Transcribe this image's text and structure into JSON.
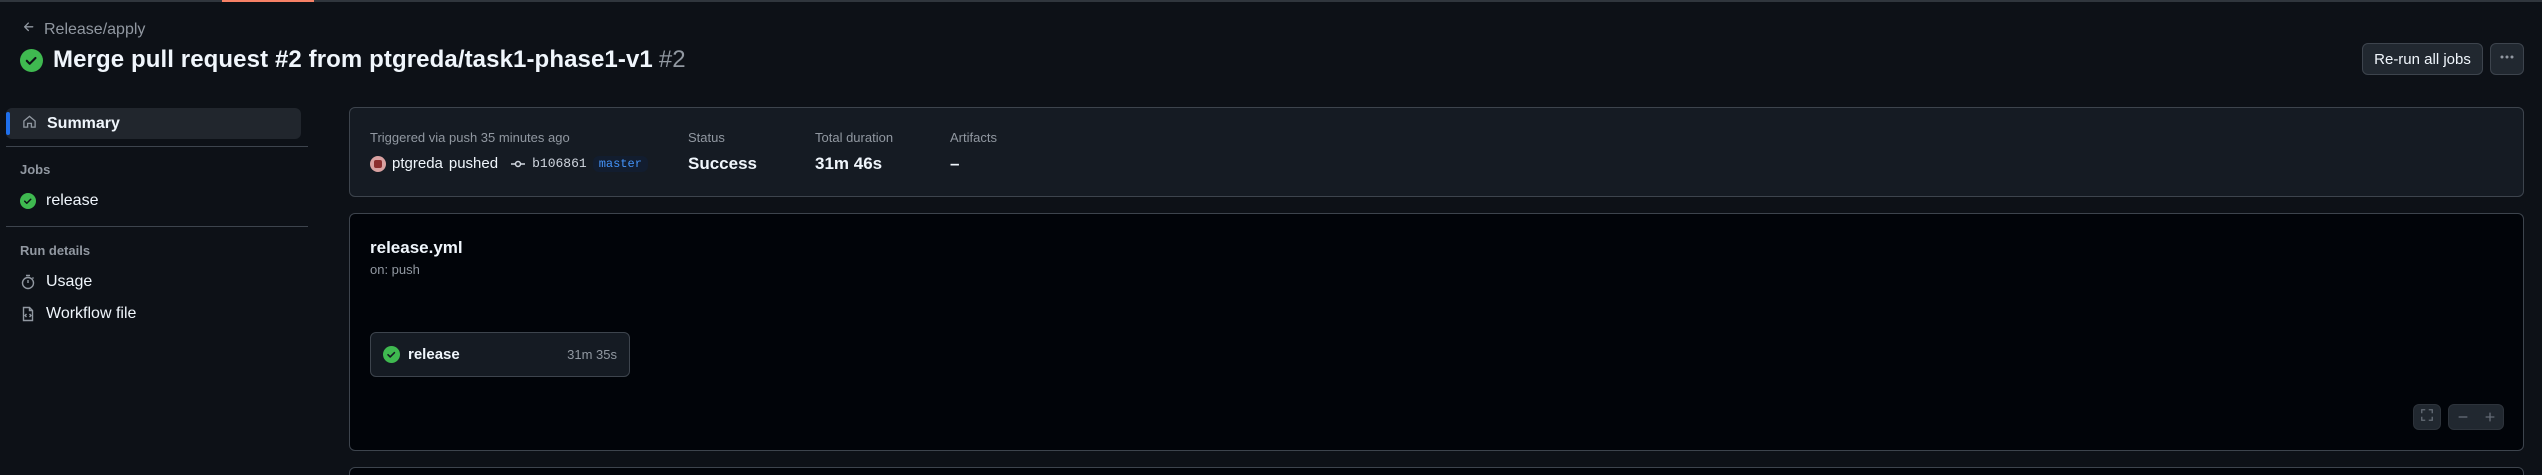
{
  "breadcrumb": {
    "back_label": "Release/apply"
  },
  "header": {
    "title": "Merge pull request #2 from ptgreda/task1-phase1-v1",
    "run_number": "#2",
    "rerun_label": "Re-run all jobs",
    "status": "success"
  },
  "sidebar": {
    "summary_label": "Summary",
    "jobs_heading": "Jobs",
    "jobs": [
      {
        "label": "release",
        "status": "success"
      }
    ],
    "run_details_heading": "Run details",
    "usage_label": "Usage",
    "workflow_file_label": "Workflow file"
  },
  "summary": {
    "trigger_label": "Triggered via push 35 minutes ago",
    "actor": "ptgreda",
    "action": "pushed",
    "commit_sha": "b106861",
    "branch": "master",
    "status_label": "Status",
    "status_value": "Success",
    "duration_label": "Total duration",
    "duration_value": "31m 46s",
    "artifacts_label": "Artifacts",
    "artifacts_value": "–"
  },
  "workflow": {
    "file_name": "release.yml",
    "trigger": "on: push",
    "job": {
      "name": "release",
      "duration": "31m 35s",
      "status": "success"
    }
  },
  "colors": {
    "background": "#0d1117",
    "success": "#3fb950",
    "accent_blue": "#1f6feb",
    "border": "#3d444d"
  },
  "icons": {
    "back": "arrow-left-icon",
    "status": "check-circle-fill-icon",
    "more": "kebab-horizontal-icon",
    "summary": "home-icon",
    "usage": "stopwatch-icon",
    "workflow_file": "file-code-icon",
    "commit": "git-commit-icon",
    "fullscreen": "screen-full-icon",
    "zoom_out": "dash-icon",
    "zoom_in": "plus-icon"
  }
}
